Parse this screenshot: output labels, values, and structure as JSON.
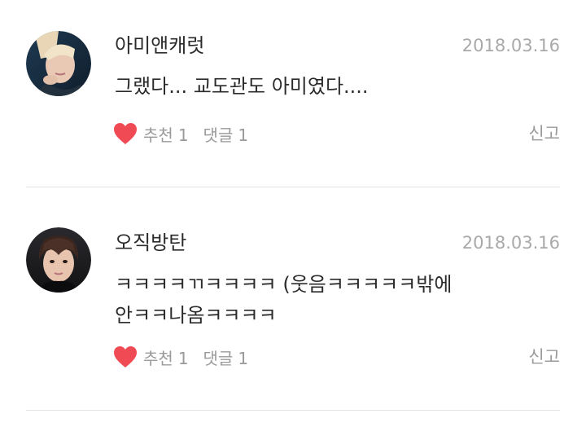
{
  "comments": [
    {
      "username": "아미앤캐럿",
      "date": "2018.03.16",
      "body_lines": [
        "그랬다... 교도관도 아미였다...."
      ],
      "like_label": "추천",
      "like_count": "1",
      "reply_label": "댓글",
      "reply_count": "1",
      "report_label": "신고",
      "avatar_icon": "user-avatar-photo"
    },
    {
      "username": "오직방탄",
      "date": "2018.03.16",
      "body_lines": [
        "ㅋㅋㅋㅋㄲㅋㅋㅋㅋ (웃음ㅋㅋㅋㅋㅋ밖에",
        "안ㅋㅋ나옴ㅋㅋㅋㅋ"
      ],
      "like_label": "추천",
      "like_count": "1",
      "reply_label": "댓글",
      "reply_count": "1",
      "report_label": "신고",
      "avatar_icon": "user-avatar-photo"
    }
  ],
  "colors": {
    "heart": "#f04b55",
    "meta_text": "#9a9a9a",
    "date_text": "#a9a9a9",
    "divider": "#e3e3e3"
  },
  "icons": {
    "like": "heart-icon"
  }
}
